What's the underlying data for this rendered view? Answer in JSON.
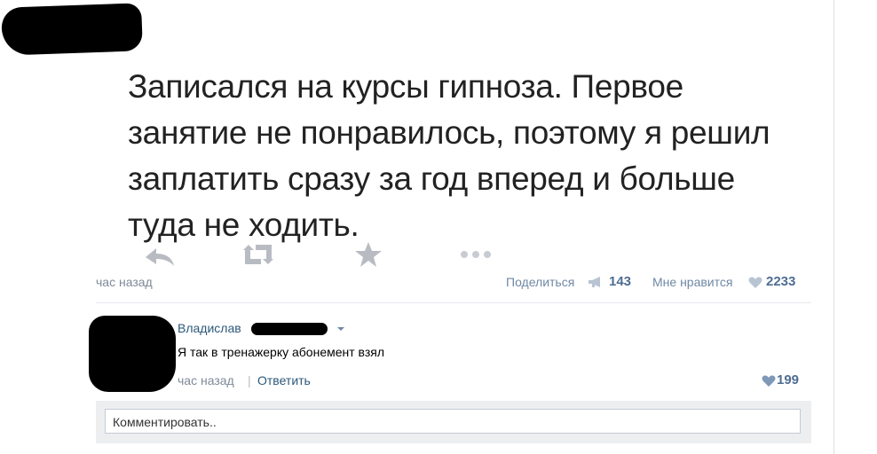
{
  "post": {
    "text": "Записался на курсы гипноза. Первое занятие не понравилось, поэтому я решил заплатить сразу за год вперед и больше туда не ходить.",
    "icons": [
      "reply-icon",
      "retweet-icon",
      "favorite-star-icon",
      "more-dots-icon"
    ],
    "time": "час назад",
    "share_label": "Поделиться",
    "share_count": "143",
    "like_label": "Мне нравится",
    "like_count": "2233"
  },
  "comment": {
    "author": "Владислав",
    "text": "Я так в тренажерку абонемент взял",
    "time": "час назад",
    "separator": "|",
    "reply_label": "Ответить",
    "like_count": "199"
  },
  "comment_box": {
    "placeholder": "Комментировать.."
  },
  "colors": {
    "link": "#2b587a",
    "muted": "#7f8a99",
    "count": "#4e6d92",
    "icon_gray": "#b8bcc2"
  }
}
